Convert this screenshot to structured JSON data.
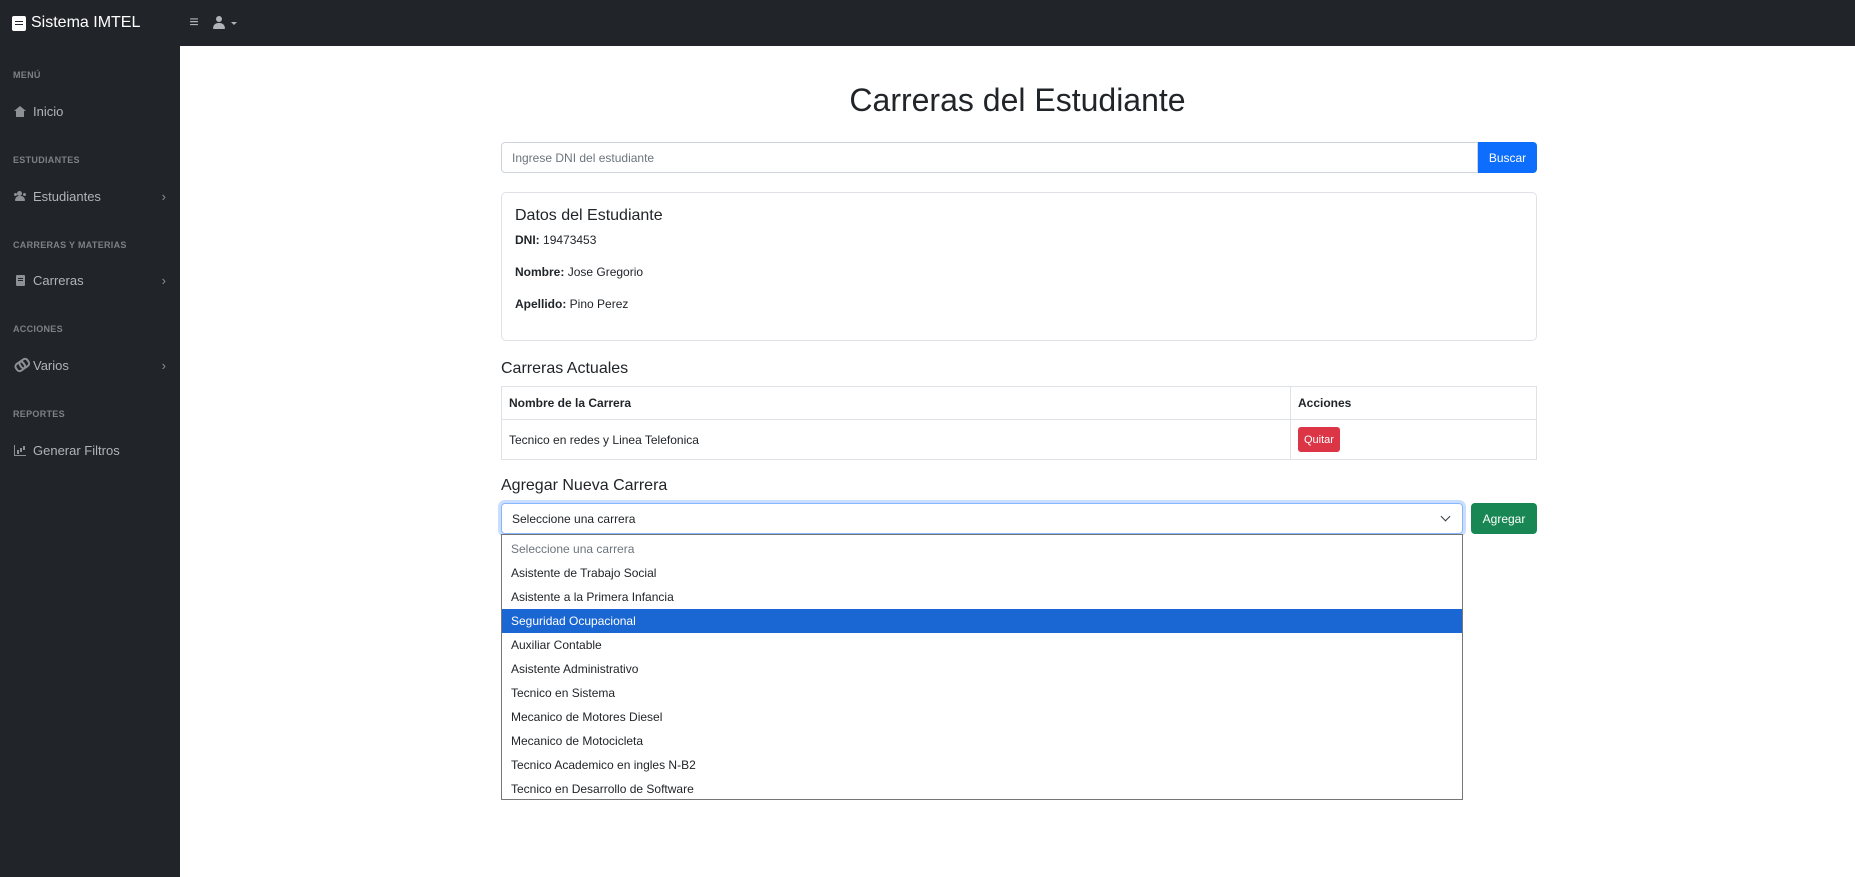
{
  "app": {
    "brand": "Sistema IMTEL"
  },
  "topbar": {
    "toggle_icon": "≡"
  },
  "sidebar": {
    "sections": [
      {
        "heading": "MENÚ",
        "item": "Inicio",
        "icon": "home-icon",
        "has_submenu": false
      },
      {
        "heading": "ESTUDIANTES",
        "item": "Estudiantes",
        "icon": "users-icon",
        "has_submenu": true
      },
      {
        "heading": "CARRERAS Y MATERIAS",
        "item": "Carreras",
        "icon": "book-icon",
        "has_submenu": true
      },
      {
        "heading": "ACCIONES",
        "item": "Varios",
        "icon": "link-icon",
        "has_submenu": true
      },
      {
        "heading": "REPORTES",
        "item": "Generar Filtros",
        "icon": "chart-icon",
        "has_submenu": false
      }
    ]
  },
  "main": {
    "title": "Carreras del Estudiante",
    "search": {
      "placeholder": "Ingrese DNI del estudiante",
      "value": "",
      "button": "Buscar"
    },
    "student_card": {
      "title": "Datos del Estudiante",
      "fields": [
        {
          "label": "DNI:",
          "value": "19473453"
        },
        {
          "label": "Nombre:",
          "value": "Jose Gregorio"
        },
        {
          "label": "Apellido:",
          "value": "Pino Perez"
        }
      ]
    },
    "current_careers": {
      "title": "Carreras Actuales",
      "columns": [
        "Nombre de la Carrera",
        "Acciones"
      ],
      "rows": [
        {
          "name": "Tecnico en redes y Linea Telefonica",
          "action": "Quitar"
        }
      ]
    },
    "add_career": {
      "title": "Agregar Nueva Carrera",
      "select_value": "Seleccione una carrera",
      "button": "Agregar",
      "options": [
        "Seleccione una carrera",
        "Asistente de Trabajo Social",
        "Asistente a la Primera Infancia",
        "Seguridad Ocupacional",
        "Auxiliar Contable",
        "Asistente Administrativo",
        "Tecnico en Sistema",
        "Mecanico de Motores Diesel",
        "Mecanico de Motocicleta",
        "Tecnico Academico en ingles N-B2",
        "Tecnico en Desarrollo de Software"
      ],
      "highlighted_index": 3
    }
  },
  "colors": {
    "dark_bg": "#212529",
    "primary": "#0d6efd",
    "danger": "#dc3545",
    "success": "#198754",
    "highlight": "#1a66d2"
  }
}
